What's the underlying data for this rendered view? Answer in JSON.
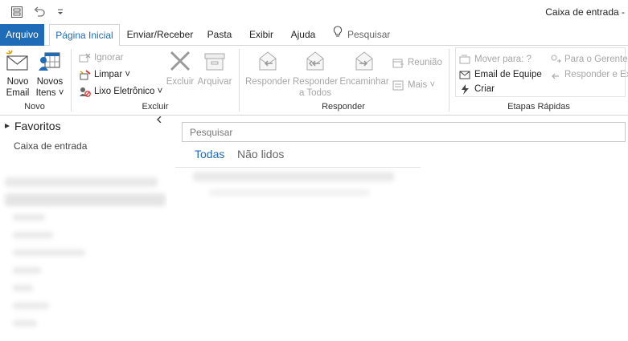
{
  "window": {
    "title": "Caixa de entrada -"
  },
  "qat": {
    "icons": [
      "send-receive-icon",
      "undo-icon",
      "customize-icon"
    ]
  },
  "tabs": [
    {
      "label": "Arquivo"
    },
    {
      "label": "Página Inicial"
    },
    {
      "label": "Enviar/Receber"
    },
    {
      "label": "Pasta"
    },
    {
      "label": "Exibir"
    },
    {
      "label": "Ajuda"
    }
  ],
  "tell_me": {
    "label": "Pesquisar",
    "icon": "lightbulb-icon"
  },
  "ribbon": {
    "novo": {
      "label": "Novo",
      "novo_email": "Novo Email",
      "novos_itens": "Novos Itens ˅"
    },
    "excluir": {
      "label": "Excluir",
      "ignorar": "Ignorar",
      "limpar": "Limpar ˅",
      "lixo": "Lixo Eletrônico ˅",
      "excluir_btn": "Excluir",
      "arquivar": "Arquivar"
    },
    "responder": {
      "label": "Responder",
      "responder_btn": "Responder",
      "responder_todos": "Responder a Todos",
      "encaminhar": "Encaminhar",
      "reuniao": "Reunião",
      "mais": "Mais ˅"
    },
    "etapas": {
      "label": "Etapas Rápidas",
      "mover": "Mover para: ?",
      "email_equipe": "Email de Equipe",
      "criar": "Criar",
      "para_gerente": "Para o Gerente",
      "responder_ex": "Responder e Ex..."
    }
  },
  "left": {
    "favoritos": "Favoritos",
    "caixa": "Caixa de entrada"
  },
  "main": {
    "search_placeholder": "Pesquisar",
    "filters": [
      "Todas",
      "Não lidos"
    ]
  },
  "colors": {
    "accent": "#1e6bb8",
    "disabled": "#a6a6a6"
  }
}
